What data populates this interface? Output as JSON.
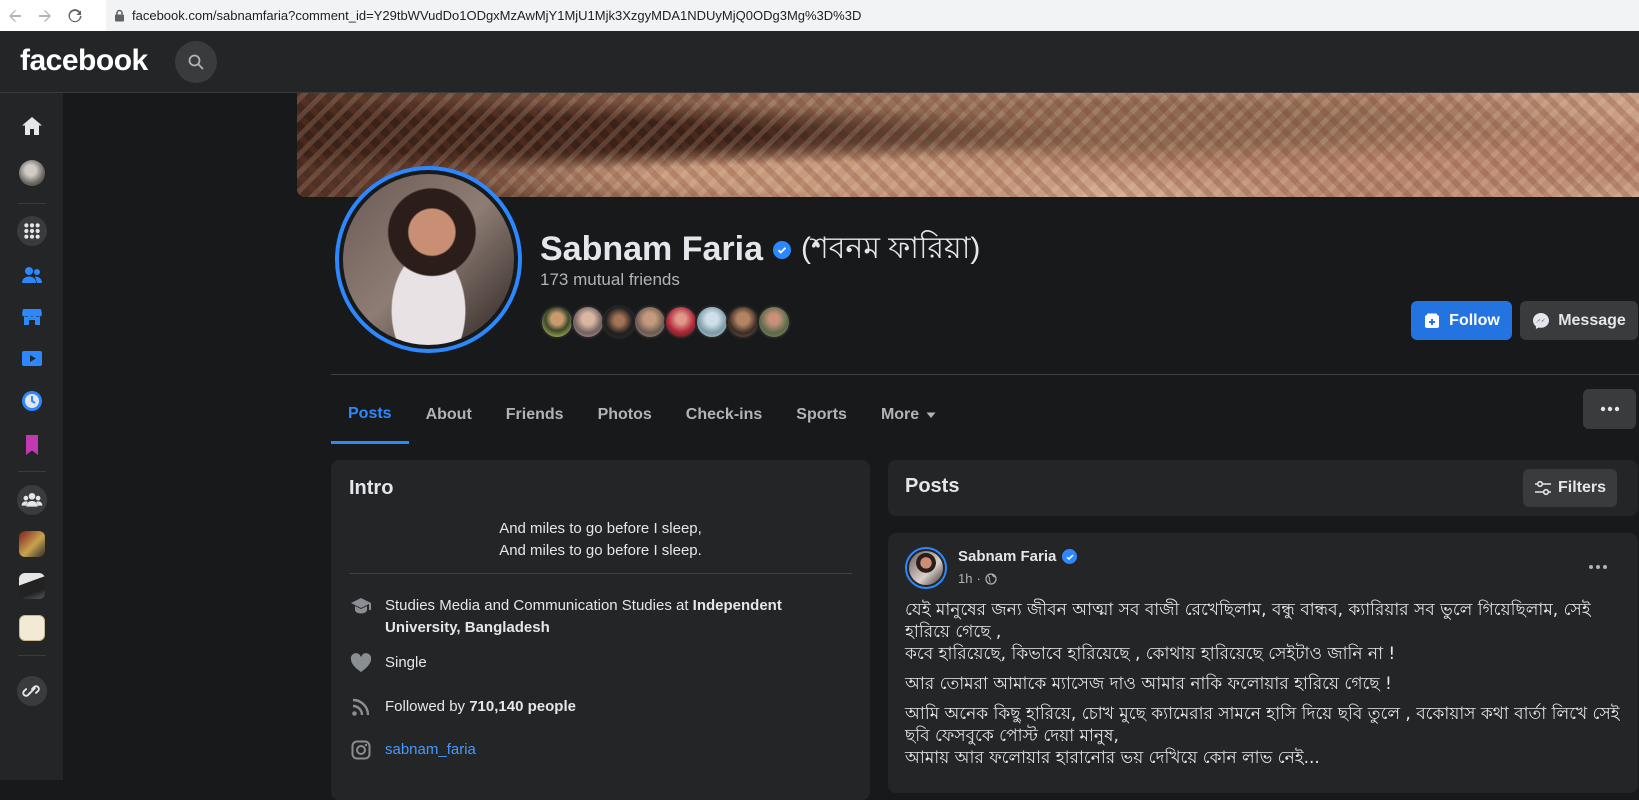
{
  "browser": {
    "url": "facebook.com/sabnamfaria?comment_id=Y29tbWVudDo1ODgxMzAwMjY1MjU1Mjk3XzgyMDA1NDUyMjQ0ODg3Mg%3D%3D"
  },
  "topbar": {
    "logo": "facebook"
  },
  "profile": {
    "name": "Sabnam Faria",
    "name_bn": "(শবনম ফারিয়া)",
    "mutual_friends": "173 mutual friends",
    "follow_label": "Follow",
    "message_label": "Message"
  },
  "tabs": [
    {
      "label": "Posts"
    },
    {
      "label": "About"
    },
    {
      "label": "Friends"
    },
    {
      "label": "Photos"
    },
    {
      "label": "Check-ins"
    },
    {
      "label": "Sports"
    },
    {
      "label": "More"
    }
  ],
  "intro": {
    "title": "Intro",
    "bio_line1": "And miles to go before I sleep,",
    "bio_line2": "And miles to go before I sleep.",
    "education_prefix": "Studies Media and Communication Studies at ",
    "education_school": "Independent University, Bangladesh",
    "relationship": "Single",
    "followed_prefix": "Followed by ",
    "followed_count": "710,140 people",
    "instagram": "sabnam_faria"
  },
  "posts": {
    "title": "Posts",
    "filters_label": "Filters",
    "author": "Sabnam Faria",
    "time": "1h",
    "meta_sep": "·",
    "para1_line1": "যেই মানুষের জন্য জীবন আত্মা সব বাজী রেখেছিলাম, বন্ধু বান্ধব, ক্যারিয়ার সব ভুলে গিয়েছিলাম, সেই হারিয়ে গেছে ,",
    "para1_line2": "কবে হারিয়েছে, কিভাবে হারিয়েছে , কোথায় হারিয়েছে সেইটাও জানি না !",
    "para2": "আর তোমরা আমাকে ম্যাসেজ দাও আমার নাকি ফলোয়ার হারিয়ে গেছে !",
    "para3_line1": "আমি অনেক কিছু হারিয়ে, চোখ মুছে ক্যামেরার সামনে হাসি দিয়ে ছবি তুলে , বকোয়াস কথা বার্তা লিখে সেই ছবি ফেসবুকে পোস্ট দেয়া মানুষ,",
    "para3_line2": "আমায় আর ফলোয়ার হারানোর ভয় দেখিয়ে কোন লাভ নেই..."
  },
  "colors": {
    "accent": "#2d88ff",
    "bg": "#18191a",
    "card": "#242526"
  }
}
